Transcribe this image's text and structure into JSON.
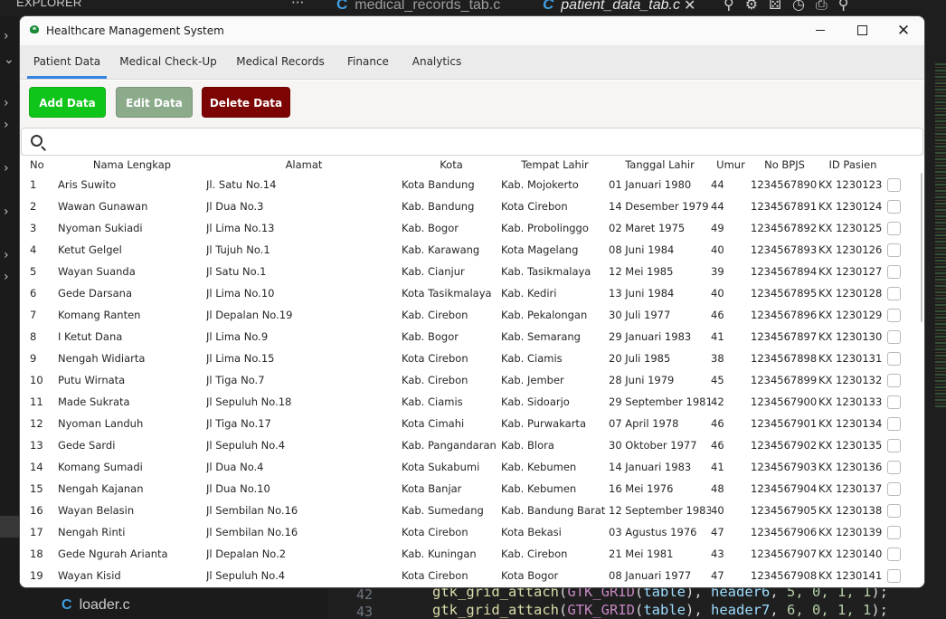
{
  "ide": {
    "explorer_label": "EXPLORER",
    "tabs": [
      {
        "label": "medical_records_tab.c"
      },
      {
        "label": "patient_data_tab.c"
      }
    ],
    "bottom_file": "loader.c",
    "line_numbers": [
      "42",
      "43"
    ],
    "code_lines": [
      {
        "fn": "gtk_grid_attach",
        "macro": "GTK_GRID",
        "arg": "table",
        "header": "header6",
        "nums": "5, 0, 1, 1"
      },
      {
        "fn": "gtk_grid_attach",
        "macro": "GTK_GRID",
        "arg": "table",
        "header": "header7",
        "nums": "6, 0, 1, 1"
      }
    ]
  },
  "window": {
    "title": "Healthcare Management System",
    "close_glyph": "✕"
  },
  "tabs": [
    {
      "label": "Patient Data",
      "active": true
    },
    {
      "label": "Medical Check-Up",
      "active": false
    },
    {
      "label": "Medical Records",
      "active": false
    },
    {
      "label": "Finance",
      "active": false
    },
    {
      "label": "Analytics",
      "active": false
    }
  ],
  "actions": {
    "add_label": "Add Data",
    "edit_label": "Edit Data",
    "delete_label": "Delete Data",
    "add_color": "#10c51a",
    "edit_color": "#8bab8a",
    "delete_color": "#7c0503"
  },
  "search": {
    "value": "",
    "placeholder": ""
  },
  "table": {
    "columns": [
      "No",
      "Nama Lengkap",
      "Alamat",
      "Kota",
      "Tempat Lahir",
      "Tanggal Lahir",
      "Umur",
      "No BPJS",
      "ID Pasien"
    ],
    "rows": [
      [
        "1",
        "Aris Suwito",
        "Jl. Satu No.14",
        "Kota Bandung",
        "Kab. Mojokerto",
        "01 Januari 1980",
        "44",
        "1234567890",
        "KX 1230123"
      ],
      [
        "2",
        "Wawan Gunawan",
        "Jl Dua No.3",
        "Kab. Bandung",
        "Kota Cirebon",
        "14 Desember 1979",
        "44",
        "1234567891",
        "KX 1230124"
      ],
      [
        "3",
        "Nyoman Sukiadi",
        "Jl Lima No.13",
        "Kab. Bogor",
        "Kab. Probolinggo",
        "02 Maret 1975",
        "49",
        "1234567892",
        "KX 1230125"
      ],
      [
        "4",
        "Ketut Gelgel",
        "Jl Tujuh No.1",
        "Kab. Karawang",
        "Kota Magelang",
        "08 Juni 1984",
        "40",
        "1234567893",
        "KX 1230126"
      ],
      [
        "5",
        "Wayan Suanda",
        "Jl Satu No.1",
        "Kab. Cianjur",
        "Kab. Tasikmalaya",
        "12 Mei 1985",
        "39",
        "1234567894",
        "KX 1230127"
      ],
      [
        "6",
        "Gede Darsana",
        "Jl Lima No.10",
        "Kota Tasikmalaya",
        "Kab. Kediri",
        "13 Juni 1984",
        "40",
        "1234567895",
        "KX 1230128"
      ],
      [
        "7",
        "Komang Ranten",
        "Jl Depalan No.19",
        "Kab. Cirebon",
        "Kab. Pekalongan",
        "30 Juli 1977",
        "46",
        "1234567896",
        "KX 1230129"
      ],
      [
        "8",
        "I Ketut Dana",
        "Jl Lima No.9",
        "Kab. Bogor",
        "Kab. Semarang",
        "29 Januari 1983",
        "41",
        "1234567897",
        "KX 1230130"
      ],
      [
        "9",
        "Nengah Widiarta",
        "Jl Lima No.15",
        "Kota Cirebon",
        "Kab. Ciamis",
        "20 Juli 1985",
        "38",
        "1234567898",
        "KX 1230131"
      ],
      [
        "10",
        "Putu Wirnata",
        "Jl Tiga No.7",
        "Kab. Cirebon",
        "Kab. Jember",
        "28 Juni 1979",
        "45",
        "1234567899",
        "KX 1230132"
      ],
      [
        "11",
        "Made Sukrata",
        "Jl Sepuluh No.18",
        "Kab. Ciamis",
        "Kab. Sidoarjo",
        "29 September 1981",
        "42",
        "1234567900",
        "KX 1230133"
      ],
      [
        "12",
        "Nyoman Landuh",
        "Jl Tiga No.17",
        "Kota Cimahi",
        "Kab. Purwakarta",
        "07 April 1978",
        "46",
        "1234567901",
        "KX 1230134"
      ],
      [
        "13",
        "Gede Sardi",
        "Jl Sepuluh No.4",
        "Kab. Pangandaran",
        "Kab. Blora",
        "30 Oktober 1977",
        "46",
        "1234567902",
        "KX 1230135"
      ],
      [
        "14",
        "Komang Sumadi",
        "Jl Dua No.4",
        "Kota Sukabumi",
        "Kab. Kebumen",
        "14 Januari 1983",
        "41",
        "1234567903",
        "KX 1230136"
      ],
      [
        "15",
        "Nengah Kajanan",
        "Jl Dua No.10",
        "Kota Banjar",
        "Kab. Kebumen",
        "16 Mei 1976",
        "48",
        "1234567904",
        "KX 1230137"
      ],
      [
        "16",
        "Wayan Belasin",
        "Jl Sembilan No.16",
        "Kab. Sumedang",
        "Kab. Bandung Barat",
        "12 September 1983",
        "40",
        "1234567905",
        "KX 1230138"
      ],
      [
        "17",
        "Nengah Rinti",
        "Jl Sembilan No.16",
        "Kota Cirebon",
        "Kota Bekasi",
        "03 Agustus 1976",
        "47",
        "1234567906",
        "KX 1230139"
      ],
      [
        "18",
        "Gede Ngurah Arianta",
        "Jl Depalan No.2",
        "Kab. Kuningan",
        "Kab. Cirebon",
        "21 Mei 1981",
        "43",
        "1234567907",
        "KX 1230140"
      ],
      [
        "19",
        "Wayan Kisid",
        "Jl Sepuluh No.4",
        "Kota Cirebon",
        "Kota Bogor",
        "08 Januari 1977",
        "47",
        "1234567908",
        "KX 1230141"
      ]
    ]
  }
}
